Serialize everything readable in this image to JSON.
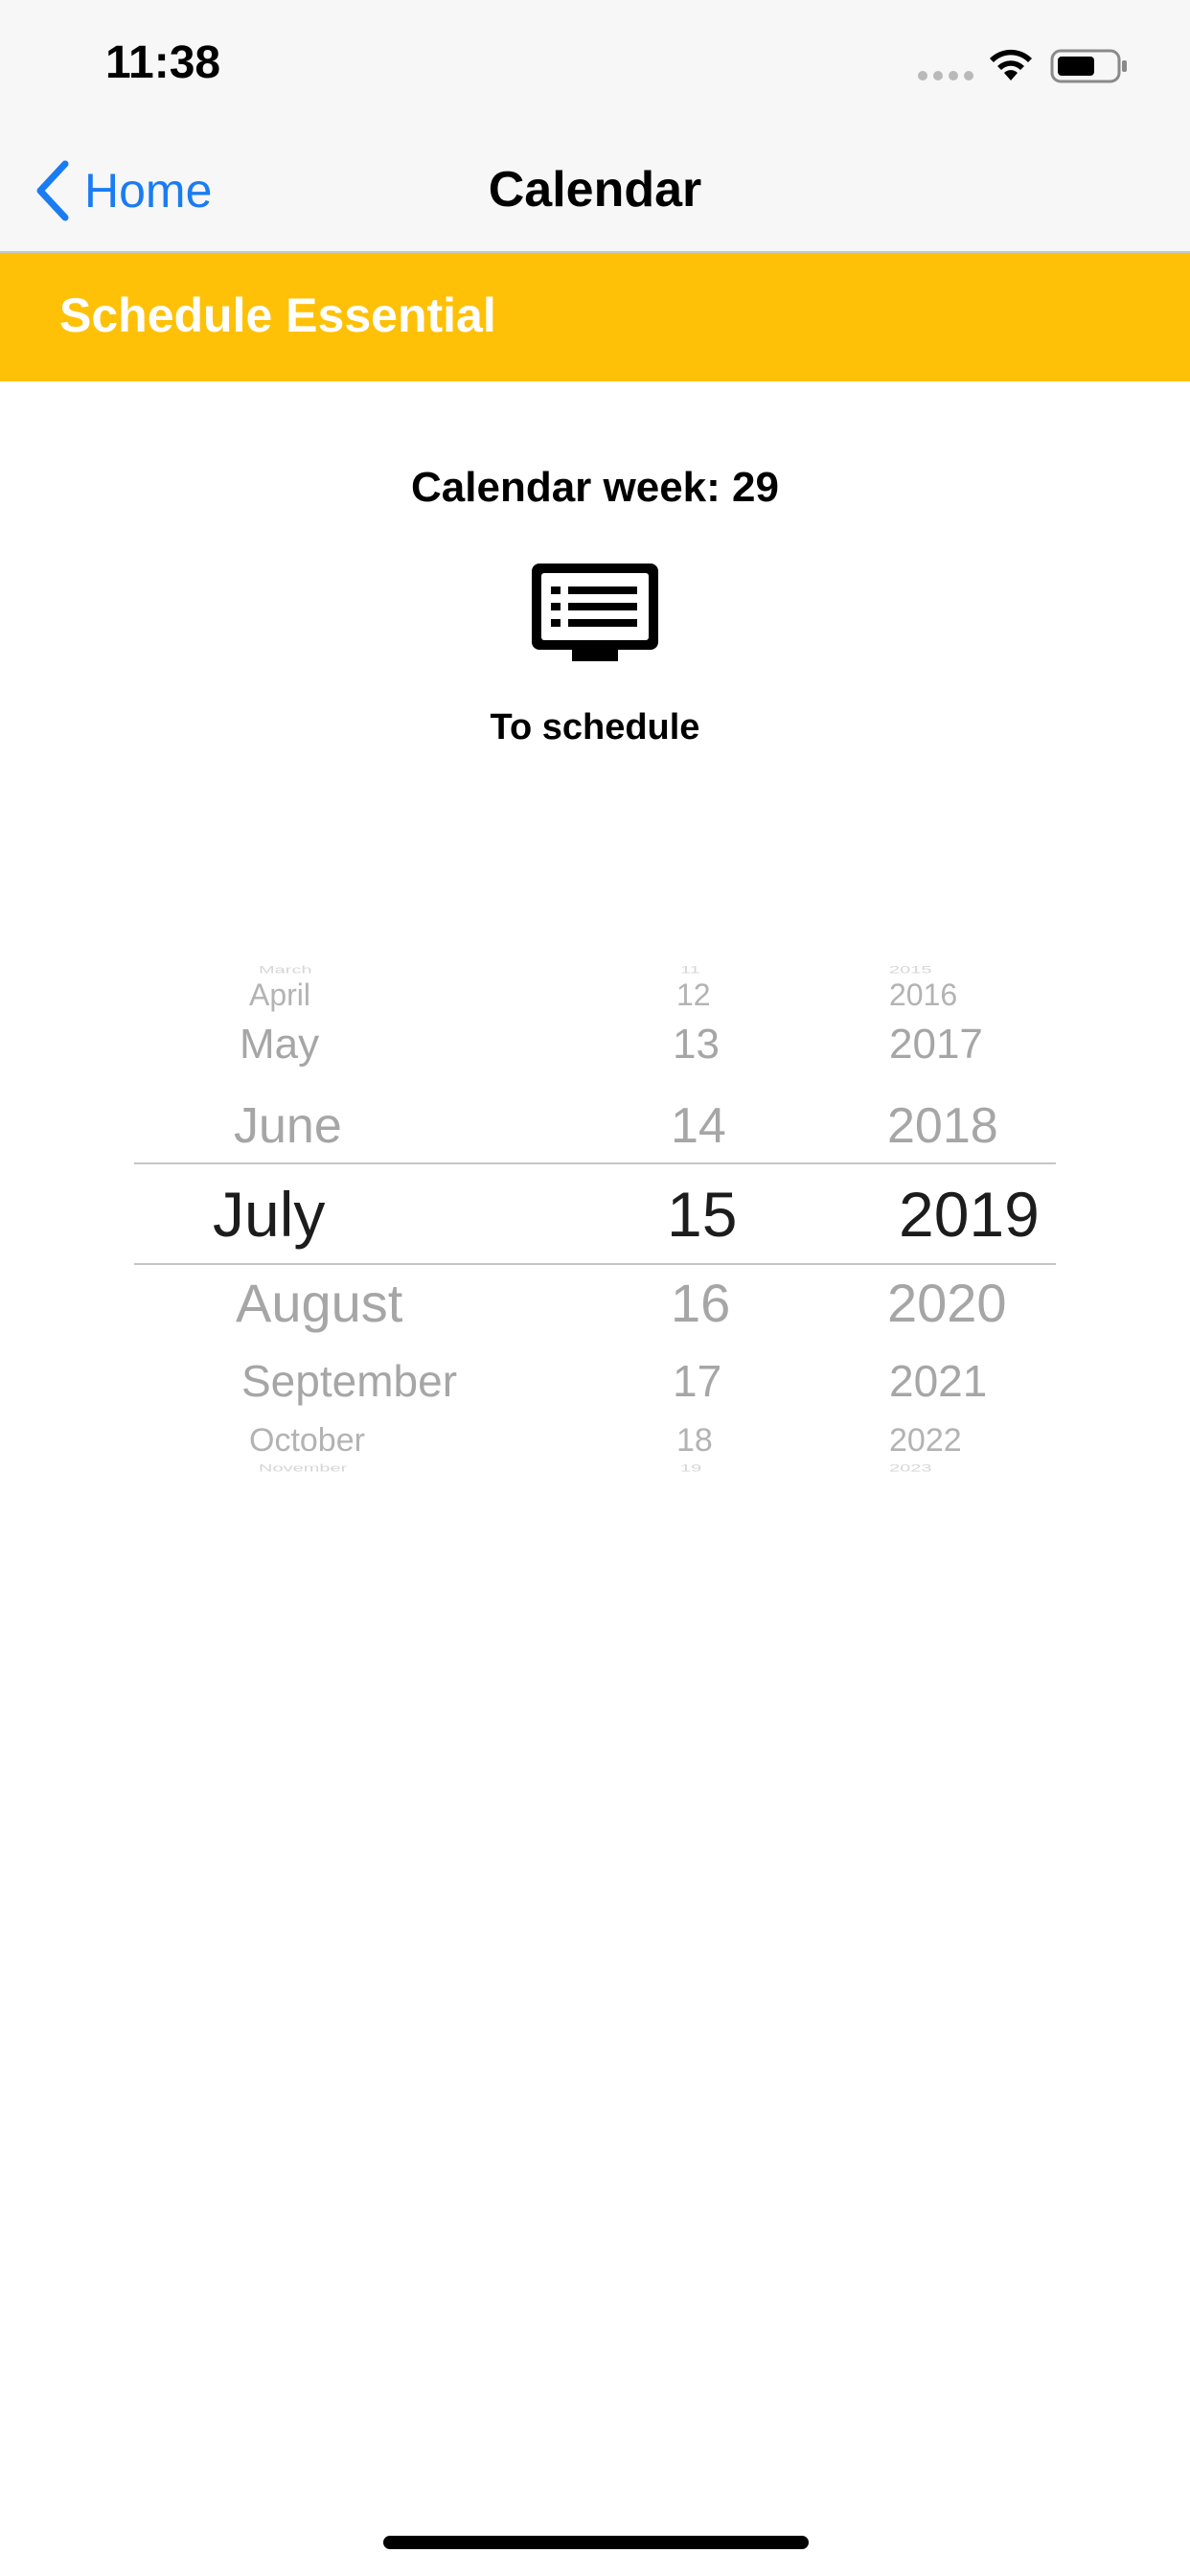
{
  "status_bar": {
    "time": "11:38"
  },
  "nav": {
    "back_label": "Home",
    "title": "Calendar"
  },
  "banner": {
    "title": "Schedule Essential"
  },
  "week": {
    "label": "Calendar week:",
    "number": "29"
  },
  "schedule": {
    "label": "To schedule"
  },
  "picker": {
    "months": [
      "March",
      "April",
      "May",
      "June",
      "July",
      "August",
      "September",
      "October",
      "November"
    ],
    "days": [
      "11",
      "12",
      "13",
      "14",
      "15",
      "16",
      "17",
      "18",
      "19"
    ],
    "years": [
      "2015",
      "2016",
      "2017",
      "2018",
      "2019",
      "2020",
      "2021",
      "2022",
      "2023"
    ],
    "selected": {
      "month": "July",
      "day": "15",
      "year": "2019"
    }
  },
  "colors": {
    "banner": "#ffc107",
    "link": "#1a7cf2"
  }
}
